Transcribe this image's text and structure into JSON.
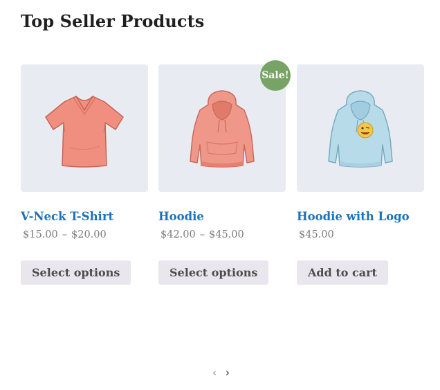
{
  "section": {
    "title": "Top Seller Products"
  },
  "products": [
    {
      "name": "V-Neck T-Shirt",
      "image_icon": "vneck-tshirt-icon",
      "price_currency_min": "$",
      "price_min": "15.00",
      "price_separator": "–",
      "price_currency_max": "$",
      "price_max": "20.00",
      "button_label": "Select options",
      "badge": ""
    },
    {
      "name": "Hoodie",
      "image_icon": "hoodie-icon",
      "price_currency_min": "$",
      "price_min": "42.00",
      "price_separator": "–",
      "price_currency_max": "$",
      "price_max": "45.00",
      "button_label": "Select options",
      "badge": "Sale!"
    },
    {
      "name": "Hoodie with Logo",
      "image_icon": "hoodie-with-logo-icon",
      "price_currency_min": "$",
      "price_min": "45.00",
      "button_label": "Add to cart",
      "badge": ""
    }
  ],
  "pager": {
    "prev_icon": "chevron-left-icon",
    "next_icon": "chevron-right-icon",
    "prev_glyph": "‹",
    "next_glyph": "›"
  },
  "colors": {
    "title": "#1f1f1f",
    "product_link": "#1b72b8",
    "price": "#7b7b7b",
    "button_bg": "#e9e6ed",
    "button_text": "#4d4d4d",
    "sale_badge": "#77a464",
    "image_bg": "#e8ebf2",
    "tshirt": "#f08f80",
    "hoodie": "#ef9889",
    "hoodie_logo": "#b7dbe9"
  }
}
